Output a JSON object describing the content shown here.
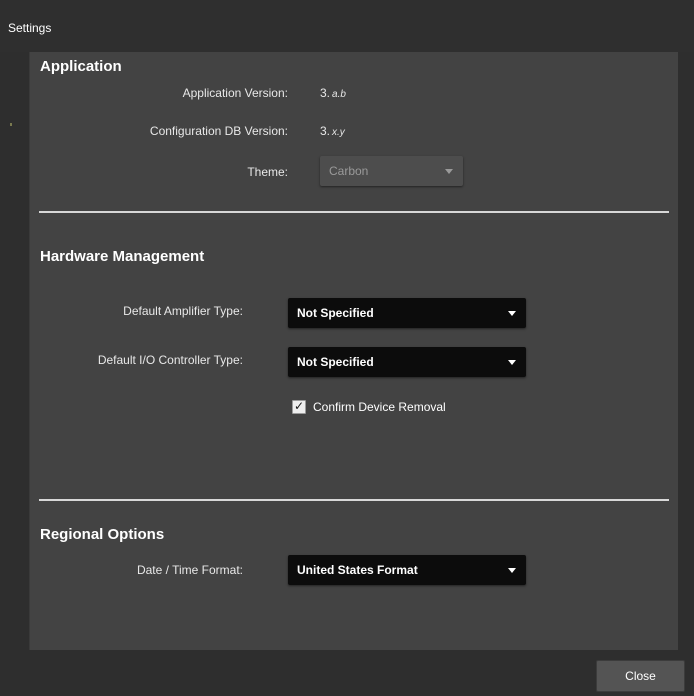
{
  "window": {
    "title": "Settings"
  },
  "application": {
    "section_title": "Application",
    "app_version_label": "Application Version:",
    "app_version_major": "3.",
    "app_version_minor": "a.b",
    "config_db_label": "Configuration DB Version:",
    "config_db_major": "3.",
    "config_db_minor": "x.y",
    "theme_label": "Theme:",
    "theme_value": "Carbon"
  },
  "hardware": {
    "section_title": "Hardware Management",
    "amplifier_label": "Default Amplifier Type:",
    "amplifier_value": "Not Specified",
    "io_controller_label": "Default I/O Controller Type:",
    "io_controller_value": "Not Specified",
    "confirm_removal_label": "Confirm Device Removal",
    "confirm_removal_checked": true
  },
  "regional": {
    "section_title": "Regional Options",
    "datetime_label": "Date / Time Format:",
    "datetime_value": "United States Format"
  },
  "footer": {
    "close_label": "Close"
  },
  "icons": {
    "dropdown_arrow": "chevron-down-icon",
    "checkbox": "checkmark-icon"
  },
  "colors": {
    "window_bg": "#2e2e2e",
    "panel_bg": "#434343",
    "dropdown_bg": "#0c0c0c",
    "text": "#ffffff"
  }
}
